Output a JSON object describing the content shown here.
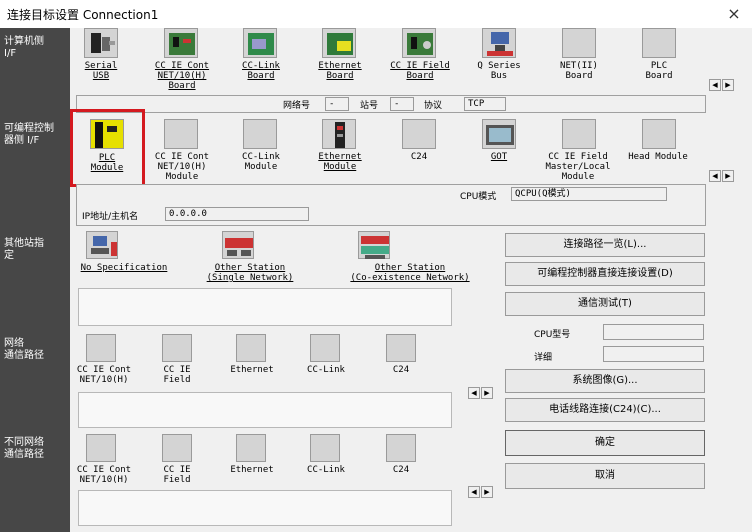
{
  "window": {
    "title": "连接目标设置 Connection1",
    "close_glyph": "×"
  },
  "sections": {
    "pc_if": "计算机侧\nI/F",
    "plc_if": "可编程控制\n器侧 I/F",
    "other_station": "其他站指\n定",
    "network_route": "网络\n通信路径",
    "diff_network": "不同网络\n通信路径"
  },
  "pc_side": {
    "items": [
      "Serial\nUSB",
      "CC IE Cont\nNET/10(H)\nBoard",
      "CC-Link\nBoard",
      "Ethernet\nBoard",
      "CC IE Field\nBoard",
      "Q Series\nBus",
      "NET(II)\nBoard",
      "PLC\nBoard"
    ],
    "network_label": "网络号",
    "network_value": "-",
    "station_label": "站号",
    "station_value": "-",
    "protocol_label": "协议",
    "protocol_value": "TCP"
  },
  "plc_side": {
    "items": [
      "PLC\nModule",
      "CC IE Cont\nNET/10(H)\nModule",
      "CC-Link\nModule",
      "Ethernet\nModule",
      "C24",
      "GOT",
      "CC IE Field\nMaster/Local\nModule",
      "Head Module"
    ],
    "cpu_mode_label": "CPU模式",
    "cpu_mode_value": "QCPU(Q模式)",
    "ip_label": "IP地址/主机名",
    "ip_value": "0.0.0.0"
  },
  "other_station": {
    "items": [
      "No Specification",
      "Other Station\n(Single Network)",
      "Other Station\n(Co-existence Network)"
    ]
  },
  "network_route": {
    "items": [
      "CC IE Cont\nNET/10(H)",
      "CC IE\nField",
      "Ethernet",
      "CC-Link",
      "C24"
    ]
  },
  "diff_network": {
    "items": [
      "CC IE Cont\nNET/10(H)",
      "CC IE\nField",
      "Ethernet",
      "CC-Link",
      "C24"
    ]
  },
  "right_panel": {
    "route_list": "连接路径一览(L)...",
    "direct_connect": "可编程控制器直接连接设置(D)",
    "comm_test": "通信测试(T)",
    "cpu_model_label": "CPU型号",
    "detail_label": "详细",
    "system_image": "系统图像(G)...",
    "phone_line": "电话线路连接(C24)(C)...",
    "ok": "确定",
    "cancel": "取消"
  },
  "scroll": {
    "left": "◀",
    "right": "▶"
  },
  "accent": "#d4191f"
}
